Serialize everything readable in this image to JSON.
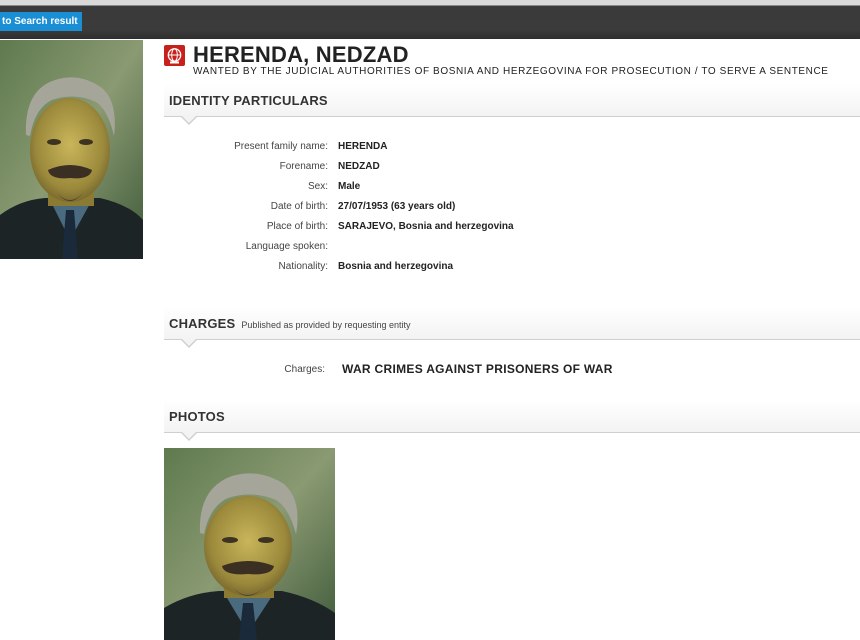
{
  "nav": {
    "back_label": "to Search result"
  },
  "notice": {
    "name": "HERENDA, NEDZAD",
    "wanted_by": "WANTED BY THE JUDICIAL AUTHORITIES OF BOSNIA AND HERZEGOVINA FOR PROSECUTION / TO SERVE A SENTENCE",
    "icon": "red-notice-icon"
  },
  "identity": {
    "title": "IDENTITY PARTICULARS",
    "fields": [
      {
        "label": "Present family name:",
        "value": "HERENDA"
      },
      {
        "label": "Forename:",
        "value": "NEDZAD"
      },
      {
        "label": "Sex:",
        "value": "Male"
      },
      {
        "label": "Date of birth:",
        "value": "27/07/1953 (63 years old)"
      },
      {
        "label": "Place of birth:",
        "value": "SARAJEVO, Bosnia and herzegovina"
      },
      {
        "label": "Language spoken:",
        "value": ""
      },
      {
        "label": "Nationality:",
        "value": "Bosnia and herzegovina"
      }
    ]
  },
  "charges": {
    "title": "CHARGES",
    "subtitle": "Published as provided by requesting entity",
    "label": "Charges:",
    "value": "WAR CRIMES AGAINST PRISONERS OF WAR"
  },
  "photos": {
    "title": "PHOTOS"
  },
  "colors": {
    "accent": "#1a8fd6",
    "notice_red": "#c8211b",
    "topbar": "#3a3a3a"
  }
}
